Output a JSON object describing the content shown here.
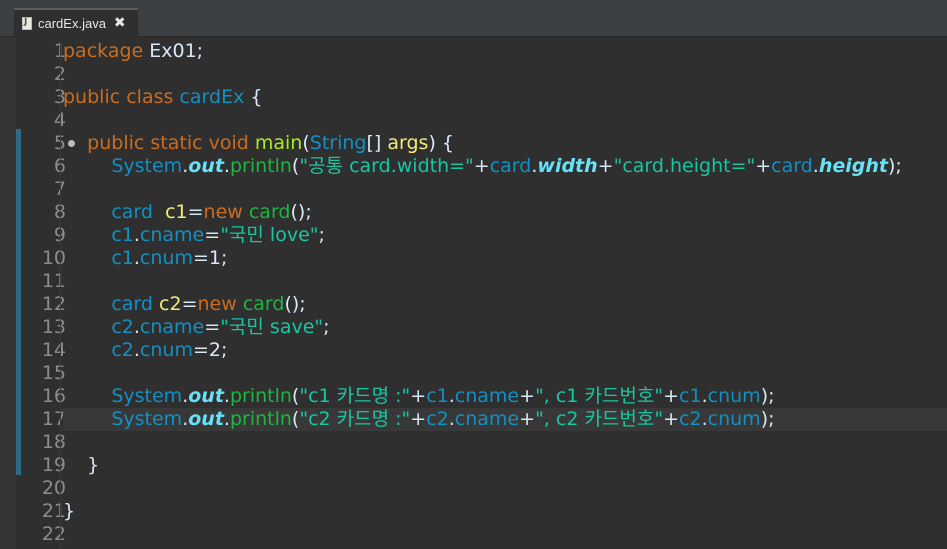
{
  "tab": {
    "label": "cardEx.java",
    "close_glyph": "✖"
  },
  "line_numbers": [
    "1",
    "2",
    "3",
    "4",
    "5",
    "6",
    "7",
    "8",
    "9",
    "10",
    "11",
    "12",
    "13",
    "14",
    "15",
    "16",
    "17",
    "18",
    "19",
    "20",
    "21",
    "22"
  ],
  "code": {
    "l1": [
      [
        "kw",
        "package"
      ],
      [
        "id",
        " Ex01;"
      ]
    ],
    "l2": [],
    "l3": [
      [
        "kw",
        "public"
      ],
      [
        "id",
        " "
      ],
      [
        "kw",
        "class"
      ],
      [
        "id",
        " "
      ],
      [
        "typ",
        "cardEx"
      ],
      [
        "id",
        " {"
      ]
    ],
    "l4": [],
    "l5": [
      [
        "id",
        "    "
      ],
      [
        "kw",
        "public"
      ],
      [
        "id",
        " "
      ],
      [
        "kw",
        "static"
      ],
      [
        "id",
        " "
      ],
      [
        "kw",
        "void"
      ],
      [
        "id",
        " "
      ],
      [
        "mth",
        "main"
      ],
      [
        "id",
        "("
      ],
      [
        "typ",
        "String"
      ],
      [
        "id",
        "[] "
      ],
      [
        "var",
        "args"
      ],
      [
        "id",
        ") {"
      ]
    ],
    "l6": [
      [
        "id",
        "        "
      ],
      [
        "typ",
        "System"
      ],
      [
        "id",
        "."
      ],
      [
        "fld",
        "out"
      ],
      [
        "id",
        "."
      ],
      [
        "fn",
        "println"
      ],
      [
        "id",
        "("
      ],
      [
        "str",
        "\"공통 card.width=\""
      ],
      [
        "id",
        "+"
      ],
      [
        "typ",
        "card"
      ],
      [
        "id",
        "."
      ],
      [
        "fld",
        "width"
      ],
      [
        "id",
        "+"
      ],
      [
        "str",
        "\"card.height=\""
      ],
      [
        "id",
        "+"
      ],
      [
        "typ",
        "card"
      ],
      [
        "id",
        "."
      ],
      [
        "fld",
        "height"
      ],
      [
        "id",
        ");"
      ]
    ],
    "l7": [],
    "l8": [
      [
        "id",
        "        "
      ],
      [
        "typ",
        "card"
      ],
      [
        "id",
        "  "
      ],
      [
        "var",
        "c1"
      ],
      [
        "id",
        "="
      ],
      [
        "kw",
        "new"
      ],
      [
        "id",
        " "
      ],
      [
        "fn",
        "card"
      ],
      [
        "id",
        "();"
      ]
    ],
    "l9": [
      [
        "id",
        "        "
      ],
      [
        "typ",
        "c1"
      ],
      [
        "id",
        "."
      ],
      [
        "typ",
        "cname"
      ],
      [
        "id",
        "="
      ],
      [
        "str",
        "\"국민 love\""
      ],
      [
        "id",
        ";"
      ]
    ],
    "l10": [
      [
        "id",
        "        "
      ],
      [
        "typ",
        "c1"
      ],
      [
        "id",
        "."
      ],
      [
        "typ",
        "cnum"
      ],
      [
        "id",
        "=1;"
      ]
    ],
    "l11": [],
    "l12": [
      [
        "id",
        "        "
      ],
      [
        "typ",
        "card"
      ],
      [
        "id",
        " "
      ],
      [
        "var",
        "c2"
      ],
      [
        "id",
        "="
      ],
      [
        "kw",
        "new"
      ],
      [
        "id",
        " "
      ],
      [
        "fn",
        "card"
      ],
      [
        "id",
        "();"
      ]
    ],
    "l13": [
      [
        "id",
        "        "
      ],
      [
        "typ",
        "c2"
      ],
      [
        "id",
        "."
      ],
      [
        "typ",
        "cname"
      ],
      [
        "id",
        "="
      ],
      [
        "str",
        "\"국민 save\""
      ],
      [
        "id",
        ";"
      ]
    ],
    "l14": [
      [
        "id",
        "        "
      ],
      [
        "typ",
        "c2"
      ],
      [
        "id",
        "."
      ],
      [
        "typ",
        "cnum"
      ],
      [
        "id",
        "=2;"
      ]
    ],
    "l15": [],
    "l16": [
      [
        "id",
        "        "
      ],
      [
        "typ",
        "System"
      ],
      [
        "id",
        "."
      ],
      [
        "fld",
        "out"
      ],
      [
        "id",
        "."
      ],
      [
        "fn",
        "println"
      ],
      [
        "id",
        "("
      ],
      [
        "str",
        "\"c1 카드명 :\""
      ],
      [
        "id",
        "+"
      ],
      [
        "typ",
        "c1"
      ],
      [
        "id",
        "."
      ],
      [
        "typ",
        "cname"
      ],
      [
        "id",
        "+"
      ],
      [
        "str",
        "\", c1 카드번호\""
      ],
      [
        "id",
        "+"
      ],
      [
        "typ",
        "c1"
      ],
      [
        "id",
        "."
      ],
      [
        "typ",
        "cnum"
      ],
      [
        "id",
        ");"
      ]
    ],
    "l17": [
      [
        "id",
        "        "
      ],
      [
        "typ",
        "System"
      ],
      [
        "id",
        "."
      ],
      [
        "fld",
        "out"
      ],
      [
        "id",
        "."
      ],
      [
        "fn",
        "println"
      ],
      [
        "id",
        "("
      ],
      [
        "str",
        "\"c2 카드명 :\""
      ],
      [
        "id",
        "+"
      ],
      [
        "typ",
        "c2"
      ],
      [
        "id",
        "."
      ],
      [
        "typ",
        "cname"
      ],
      [
        "id",
        "+"
      ],
      [
        "str",
        "\", c2 카드번호\""
      ],
      [
        "id",
        "+"
      ],
      [
        "typ",
        "c2"
      ],
      [
        "id",
        "."
      ],
      [
        "typ",
        "cnum"
      ],
      [
        "id",
        ");"
      ]
    ],
    "l18": [],
    "l19": [
      [
        "id",
        "    }"
      ]
    ],
    "l20": [],
    "l21": [
      [
        "id",
        "}"
      ]
    ],
    "l22": []
  },
  "current_line": 17
}
